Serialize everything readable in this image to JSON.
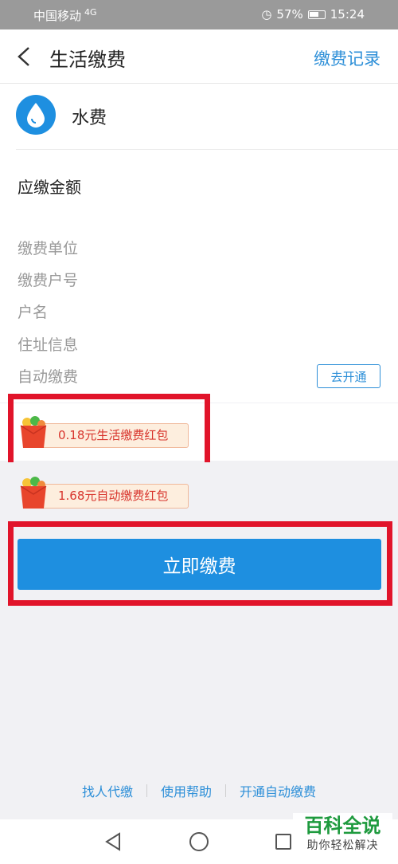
{
  "status_bar": {
    "carrier": "中国移动",
    "network": "4G",
    "battery": "57%",
    "time": "15:24"
  },
  "header": {
    "title": "生活缴费",
    "record_link": "缴费记录"
  },
  "service": {
    "name": "水费",
    "icon": "water-drop-icon"
  },
  "amount_label": "应缴金额",
  "info_items": {
    "unit": "缴费单位",
    "account": "缴费户号",
    "holder": "户名",
    "address": "住址信息",
    "auto_pay": "自动缴费"
  },
  "auto_pay_button": "去开通",
  "red_envelopes": {
    "life_pay": "0.18元生活缴费红包",
    "auto_pay": "1.68元自动缴费红包"
  },
  "pay_button": "立即缴费",
  "footer_links": {
    "proxy_pay": "找人代缴",
    "help": "使用帮助",
    "enable_auto": "开通自动缴费"
  },
  "watermark": {
    "title": "百科全说",
    "subtitle": "助你轻松解决"
  },
  "colors": {
    "accent": "#1e8fe0",
    "link": "#2d8fd8",
    "highlight": "#e1142a",
    "envelope_text": "#d8352d"
  }
}
